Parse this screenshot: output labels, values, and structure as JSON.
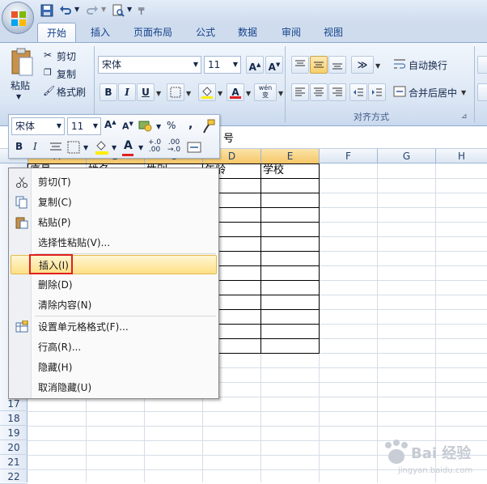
{
  "quick_access": {
    "save_icon": "save-icon",
    "undo_icon": "undo-icon",
    "redo_icon": "redo-icon",
    "preview_icon": "print-preview-icon"
  },
  "tabs": [
    "开始",
    "插入",
    "页面布局",
    "公式",
    "数据",
    "审阅",
    "视图"
  ],
  "ribbon": {
    "paste_label": "粘贴",
    "cut_label": "剪切",
    "copy_label": "复制",
    "format_painter_label": "格式刷",
    "font_name": "宋体",
    "font_size": "11",
    "bold": "B",
    "italic": "I",
    "underline": "U",
    "font_color_letter": "A",
    "wen_label": "wén\n变",
    "wrap_text_label": "自动换行",
    "merge_label": "合并后居中",
    "align_group_label": "对齐方式"
  },
  "minibar": {
    "font_name": "宋体",
    "font_size": "11",
    "percent": "%",
    "comma": ",",
    "bold": "B",
    "italic": "I",
    "inc_decimal": "+.0\n.00",
    "dec_decimal": ".00\n→.0"
  },
  "formula_bar": {
    "partial_text": "号"
  },
  "columns": [
    "A",
    "B",
    "C",
    "D",
    "E",
    "F",
    "G",
    "H"
  ],
  "rows": [
    "17",
    "18",
    "19",
    "20",
    "21",
    "22"
  ],
  "cells": {
    "a1": "序号",
    "b1": "姓名",
    "c1": "性别",
    "d1": "年龄",
    "e1": "学校"
  },
  "context_menu": {
    "items": [
      {
        "label": "剪切(T)",
        "icon": "scissors-icon"
      },
      {
        "label": "复制(C)",
        "icon": "copy-icon"
      },
      {
        "label": "粘贴(P)",
        "icon": "paste-icon"
      },
      {
        "label": "选择性粘贴(V)...",
        "icon": ""
      },
      {
        "label": "插入(I)",
        "icon": ""
      },
      {
        "label": "删除(D)",
        "icon": ""
      },
      {
        "label": "清除内容(N)",
        "icon": ""
      },
      {
        "label": "设置单元格格式(F)...",
        "icon": "format-cells-icon"
      },
      {
        "label": "行高(R)...",
        "icon": ""
      },
      {
        "label": "隐藏(H)",
        "icon": ""
      },
      {
        "label": "取消隐藏(U)",
        "icon": ""
      }
    ]
  },
  "watermark": {
    "text": "Bai 经验",
    "sub": "jingyan.baidu.com"
  },
  "colors": {
    "highlight": "#fddf86",
    "red_box": "#e02020",
    "ribbon": "#dbe6f4",
    "header_sel": "#f6c667"
  }
}
